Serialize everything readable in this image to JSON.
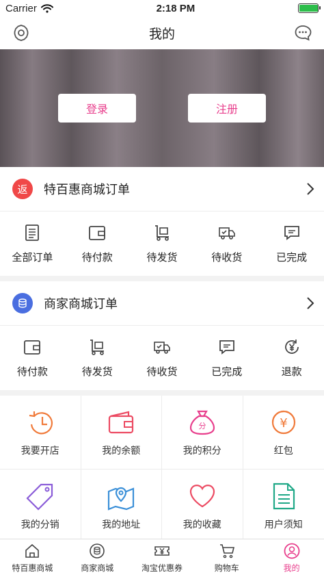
{
  "status": {
    "carrier": "Carrier",
    "time": "2:18 PM",
    "battery_level": 0.95
  },
  "nav": {
    "title": "我的",
    "left_icon": "settings-icon",
    "right_icon": "message-icon"
  },
  "hero": {
    "login": "登录",
    "register": "注册"
  },
  "tebaihui": {
    "badge": "返",
    "title": "特百惠商城订单",
    "items": [
      {
        "label": "全部订单"
      },
      {
        "label": "待付款"
      },
      {
        "label": "待发货"
      },
      {
        "label": "待收货"
      },
      {
        "label": "已完成"
      }
    ]
  },
  "merchant": {
    "title": "商家商城订单",
    "items": [
      {
        "label": "待付款"
      },
      {
        "label": "待发货"
      },
      {
        "label": "待收货"
      },
      {
        "label": "已完成"
      },
      {
        "label": "退款"
      }
    ]
  },
  "grid": [
    {
      "label": "我要开店"
    },
    {
      "label": "我的余额"
    },
    {
      "label": "我的积分"
    },
    {
      "label": "红包"
    },
    {
      "label": "我的分销"
    },
    {
      "label": "我的地址"
    },
    {
      "label": "我的收藏"
    },
    {
      "label": "用户须知"
    }
  ],
  "points_glyph": "分",
  "redpacket_glyph": "¥",
  "tabbar": [
    {
      "label": "特百惠商城"
    },
    {
      "label": "商家商城"
    },
    {
      "label": "淘宝优惠券"
    },
    {
      "label": "购物车"
    },
    {
      "label": "我的"
    }
  ],
  "colors": {
    "accent": "#e83e8c",
    "badge_red": "#f04848",
    "badge_blue": "#4a6ee0"
  }
}
